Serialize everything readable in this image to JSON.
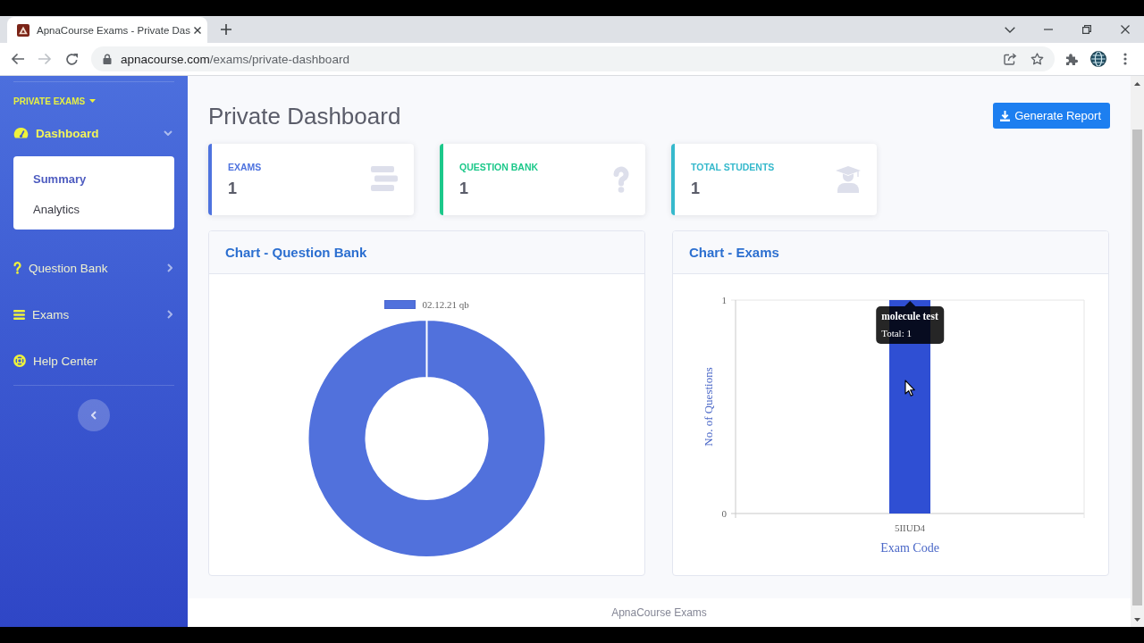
{
  "browser": {
    "tabs": [
      {
        "title": "ApnaCourse Exams - Private Das",
        "selected": true
      }
    ],
    "address": {
      "host": "apnacourse.com",
      "path": "/exams/private-dashboard"
    }
  },
  "sidebar": {
    "heading": "PRIVATE EXAMS",
    "items": [
      {
        "label": "Dashboard",
        "kind": "menu",
        "selected": true,
        "expanded": true,
        "children": [
          {
            "label": "Summary",
            "selected": true
          },
          {
            "label": "Analytics",
            "selected": false
          }
        ]
      },
      {
        "label": "Question Bank",
        "kind": "menu",
        "selected": false,
        "expanded": false
      },
      {
        "label": "Exams",
        "kind": "menu",
        "selected": false,
        "expanded": false
      },
      {
        "label": "Help Center",
        "kind": "link",
        "selected": false
      }
    ]
  },
  "header": {
    "title": "Private Dashboard",
    "button": "Generate Report"
  },
  "cards": [
    {
      "label": "EXAMS",
      "value": "1",
      "color": "#4e73df"
    },
    {
      "label": "QUESTION BANK",
      "value": "1",
      "color": "#1cc88a"
    },
    {
      "label": "TOTAL STUDENTS",
      "value": "1",
      "color": "#36b9cc"
    }
  ],
  "charts": [
    {
      "title": "Chart - Question Bank",
      "kind": "donut",
      "legend": [
        "02.12.21 qb"
      ]
    },
    {
      "title": "Chart - Exams",
      "chart_data": {
        "type": "bar",
        "xlabel": "Exam Code",
        "ylabel": "No. of Questions",
        "categories": [
          "5IIUD4"
        ],
        "values": [
          1
        ],
        "ylim": [
          0,
          1
        ],
        "yticks": [
          0,
          1
        ]
      },
      "tooltip": {
        "title": "molecule test",
        "text": "Total: 1"
      }
    }
  ],
  "footer": "ApnaCourse Exams"
}
